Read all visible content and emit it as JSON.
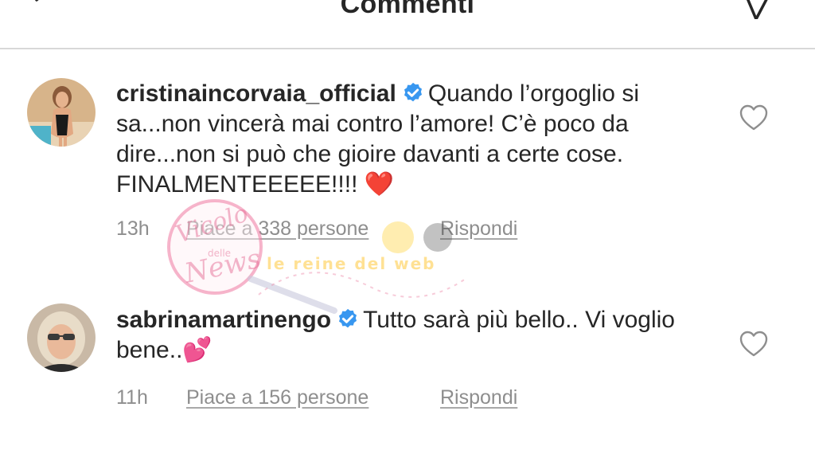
{
  "header": {
    "title": "Commenti",
    "back_icon": "chevron-left-icon",
    "send_icon": "paper-plane-icon"
  },
  "comments": [
    {
      "username": "cristinaincorvaia_official",
      "verified": true,
      "text": "Quando l’orgoglio si sa...non vincerà mai contro l’amore! C’è poco da dire...non si può che gioire davanti a certe cose. FINALMENTEEEEE!!!! ❤️",
      "time": "13h",
      "likes": "Piace a 338 persone",
      "reply": "Rispondi"
    },
    {
      "username": "sabrinamartinengo",
      "verified": true,
      "text": "Tutto sarà più bello.. Vi voglio bene..💕",
      "time": "11h",
      "likes": "Piace a 156 persone",
      "reply": "Rispondi"
    }
  ],
  "watermark": {
    "brand": "Vicolo delle News",
    "tagline": "le reine del web"
  },
  "colors": {
    "text": "#262626",
    "secondary": "#8e8e8e",
    "verified": "#3897f0",
    "divider": "#d8d8d8"
  }
}
